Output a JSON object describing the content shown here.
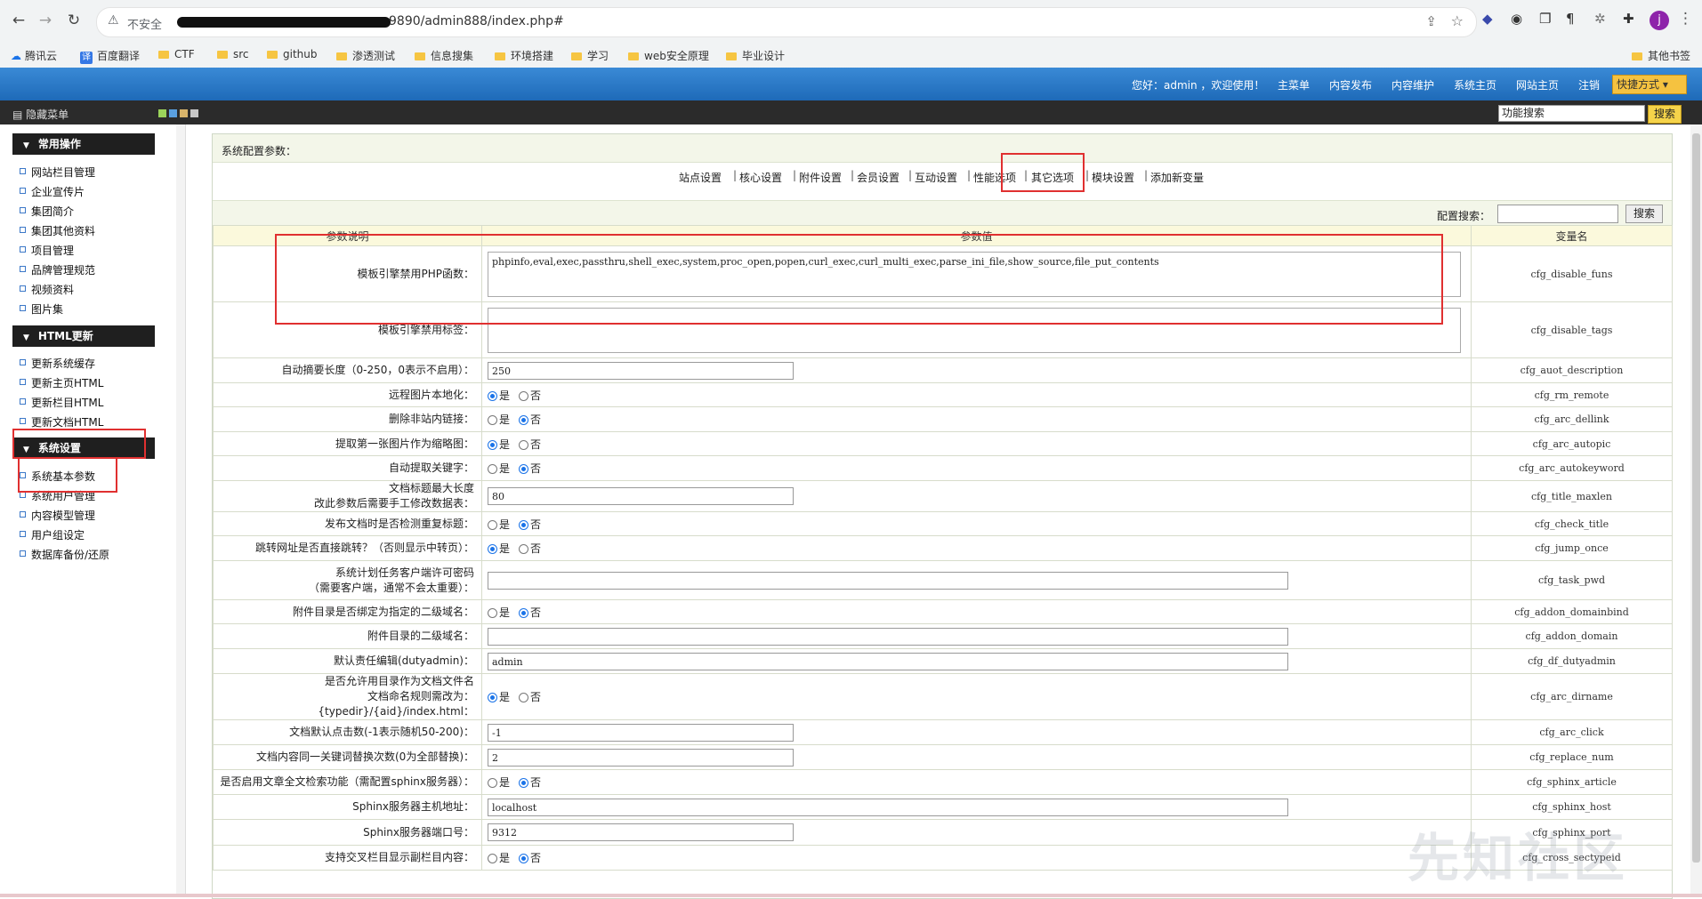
{
  "browser": {
    "insecure_label": "不安全",
    "url_text": "9890/admin888/index.php#",
    "bookmarks": [
      "腾讯云",
      "百度翻译",
      "CTF",
      "src",
      "github",
      "渗透测试",
      "信息搜集",
      "环境搭建",
      "学习",
      "web安全原理",
      "毕业设计"
    ],
    "other_bookmarks": "其他书签",
    "profile_initial": "j"
  },
  "topnav": {
    "greeting": "您好：admin ，欢迎使用！",
    "items": [
      "主菜单",
      "内容发布",
      "内容维护",
      "系统主页",
      "网站主页",
      "注销"
    ],
    "quick": "快捷方式"
  },
  "toolbar": {
    "hide_menu": "隐藏菜单",
    "search_value": "功能搜索",
    "search_button": "搜索"
  },
  "sidebar": {
    "sections": [
      {
        "title": "常用操作",
        "items": [
          "网站栏目管理",
          "企业宣传片",
          "集团简介",
          "集团其他资料",
          "项目管理",
          "品牌管理规范",
          "视频资料",
          "图片集"
        ]
      },
      {
        "title": "HTML更新",
        "items": [
          "更新系统缓存",
          "更新主页HTML",
          "更新栏目HTML",
          "更新文档HTML"
        ]
      },
      {
        "title": "系统设置",
        "items": [
          "系统基本参数",
          "系统用户管理",
          "内容模型管理",
          "用户组设定",
          "数据库备份/还原"
        ]
      }
    ]
  },
  "main": {
    "header": "系统配置参数：",
    "tabs": [
      "站点设置",
      "核心设置",
      "附件设置",
      "会员设置",
      "互动设置",
      "性能选项",
      "其它选项",
      "模块设置",
      "添加新变量"
    ],
    "cfg_search_label": "配置搜索：",
    "cfg_search_button": "搜索",
    "columns": [
      "参数说明",
      "参数值",
      "变量名"
    ],
    "yes": "是",
    "no": "否",
    "rows": [
      {
        "label": "模板引擎禁用PHP函数：",
        "type": "area",
        "value": "phpinfo,eval,exec,passthru,shell_exec,system,proc_open,popen,curl_exec,curl_multi_exec,parse_ini_file,show_source,file_put_contents",
        "var": "cfg_disable_funs"
      },
      {
        "label": "模板引擎禁用标签：",
        "type": "area",
        "value": "",
        "var": "cfg_disable_tags"
      },
      {
        "label": "自动摘要长度（0-250，0表示不启用）：",
        "type": "text",
        "width": "short",
        "value": "250",
        "var": "cfg_auot_description"
      },
      {
        "label": "远程图片本地化：",
        "type": "radio",
        "checked": "yes",
        "var": "cfg_rm_remote"
      },
      {
        "label": "删除非站内链接：",
        "type": "radio",
        "checked": "no",
        "var": "cfg_arc_dellink"
      },
      {
        "label": "提取第一张图片作为缩略图：",
        "type": "radio",
        "checked": "yes",
        "var": "cfg_arc_autopic"
      },
      {
        "label": "自动提取关键字：",
        "type": "radio",
        "checked": "no",
        "var": "cfg_arc_autokeyword"
      },
      {
        "label": "文档标题最大长度\n改此参数后需要手工修改数据表：",
        "type": "text",
        "width": "short",
        "value": "80",
        "var": "cfg_title_maxlen"
      },
      {
        "label": "发布文档时是否检测重复标题：",
        "type": "radio",
        "checked": "no",
        "var": "cfg_check_title"
      },
      {
        "label": "跳转网址是否直接跳转？（否则显示中转页）：",
        "type": "radio",
        "checked": "yes",
        "var": "cfg_jump_once"
      },
      {
        "label": "系统计划任务客户端许可密码\n（需要客户端，通常不会太重要）：",
        "type": "text",
        "width": "long",
        "value": "",
        "var": "cfg_task_pwd"
      },
      {
        "label": "附件目录是否绑定为指定的二级域名：",
        "type": "radio",
        "checked": "no",
        "var": "cfg_addon_domainbind"
      },
      {
        "label": "附件目录的二级域名：",
        "type": "text",
        "width": "long",
        "value": "",
        "var": "cfg_addon_domain"
      },
      {
        "label": "默认责任编辑(dutyadmin)：",
        "type": "text",
        "width": "long",
        "value": "admin",
        "var": "cfg_df_dutyadmin"
      },
      {
        "label": "是否允许用目录作为文档文件名\n文档命名规则需改为：{typedir}/{aid}/index.html：",
        "type": "radio",
        "checked": "yes",
        "var": "cfg_arc_dirname"
      },
      {
        "label": "文档默认点击数(-1表示随机50-200)：",
        "type": "text",
        "width": "short",
        "value": "-1",
        "var": "cfg_arc_click"
      },
      {
        "label": "文档内容同一关键词替换次数(0为全部替换)：",
        "type": "text",
        "width": "short",
        "value": "2",
        "var": "cfg_replace_num"
      },
      {
        "label": "是否启用文章全文检索功能（需配置sphinx服务器）：",
        "type": "radio",
        "checked": "no",
        "var": "cfg_sphinx_article"
      },
      {
        "label": "Sphinx服务器主机地址：",
        "type": "text",
        "width": "long",
        "value": "localhost",
        "var": "cfg_sphinx_host"
      },
      {
        "label": "Sphinx服务器端口号：",
        "type": "text",
        "width": "short",
        "value": "9312",
        "var": "cfg_sphinx_port"
      },
      {
        "label": "支持交叉栏目显示副栏目内容：",
        "type": "radio",
        "checked": "no",
        "var": "cfg_cross_sectypeid"
      }
    ]
  },
  "watermark": "先知社区"
}
